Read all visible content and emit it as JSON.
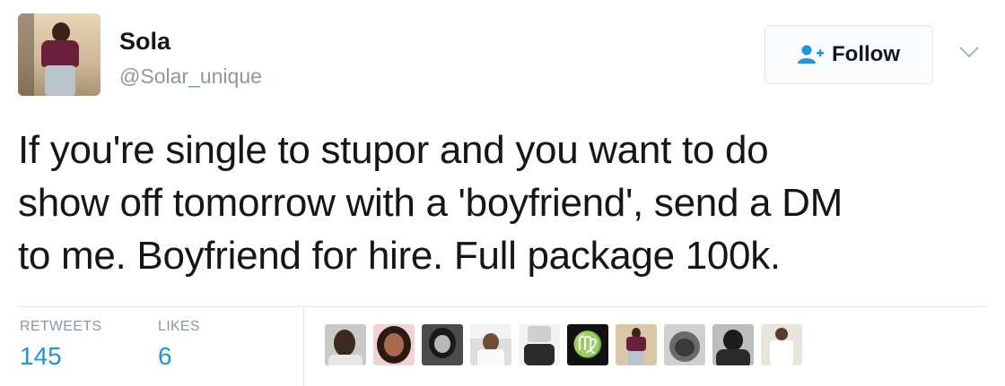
{
  "user": {
    "name": "Sola",
    "handle": "@Solar_unique"
  },
  "follow_button": {
    "label": "Follow",
    "icon": "add-user-icon"
  },
  "menu": {
    "icon": "chevron-down-icon"
  },
  "tweet": {
    "lines": [
      "If you're single to stupor and you want to do",
      "show off tomorrow with a 'boyfriend', send a DM",
      "to me. Boyfriend for hire. Full package 100k."
    ]
  },
  "stats": {
    "retweets_label": "RETWEETS",
    "retweets_value": "145",
    "likes_label": "LIKES",
    "likes_value": "6"
  },
  "colors": {
    "accent": "#1b95e0",
    "muted": "#8899a6",
    "text": "#14171a"
  }
}
